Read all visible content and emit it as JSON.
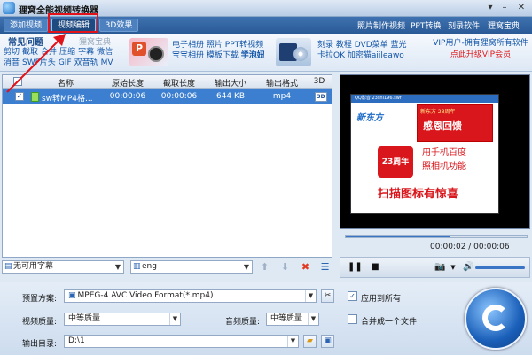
{
  "window": {
    "title": "狸窝全能视频转换器"
  },
  "toolbar": {
    "add_video": "添加视频",
    "edit_video": "视频编辑",
    "effect_3d": "3D效果",
    "links": [
      "照片制作视频",
      "PPT转换",
      "刻录软件",
      "狸窝宝典"
    ]
  },
  "banner": {
    "faq_tab": "常见问题",
    "treasure_tab": "狸窝宝典",
    "faq_links": [
      "剪切",
      "截取",
      "合并",
      "压缩",
      "字幕",
      "微信",
      "消音",
      "SWF片头",
      "GIF",
      "双音轨",
      "MV"
    ],
    "promo1": [
      "电子相册",
      "照片",
      "PPT转视频",
      "宝宝相册",
      "模板下载",
      "学泡妞"
    ],
    "promo2": [
      "刻录",
      "教程",
      "DVD菜单",
      "蓝光",
      "卡拉OK",
      "加密猫aiileawo"
    ],
    "vip_line1": "VIP用户-拥有狸窝所有软件",
    "vip_line2": "点此升级VIP会员"
  },
  "table": {
    "columns": [
      "名称",
      "原始长度",
      "截取长度",
      "输出大小",
      "输出格式",
      "3D"
    ],
    "rows": [
      {
        "checked": true,
        "name": "sw转MP4格...",
        "orig_len": "00:00:06",
        "cut_len": "00:00:06",
        "size": "644 KB",
        "format": "mp4",
        "threed": "3D"
      }
    ]
  },
  "subtitle": {
    "value": "无可用字幕"
  },
  "audio": {
    "value": "eng"
  },
  "preview": {
    "video_topbar": "QQ影音        23shi196.swf",
    "logo": "新东方",
    "ad_line1": "新东方 23周年",
    "ad_line2": "感恩回馈",
    "promo_23": "23周年",
    "side_line1": "用手机百度",
    "side_line2": "照相机功能",
    "big_text": "扫描图标有惊喜",
    "time": "00:00:02 / 00:00:06",
    "progress": 0.58
  },
  "settings": {
    "preset_label": "预置方案:",
    "preset_value": "MPEG-4 AVC Video Format(*.mp4)",
    "apply_all": "应用到所有",
    "apply_all_checked": true,
    "video_quality_label": "视频质量:",
    "video_quality_value": "中等质量",
    "audio_quality_label": "音频质量:",
    "audio_quality_value": "中等质量",
    "merge_label": "合并成一个文件",
    "merge_checked": false,
    "output_label": "输出目录:",
    "output_value": "D:\\1"
  }
}
